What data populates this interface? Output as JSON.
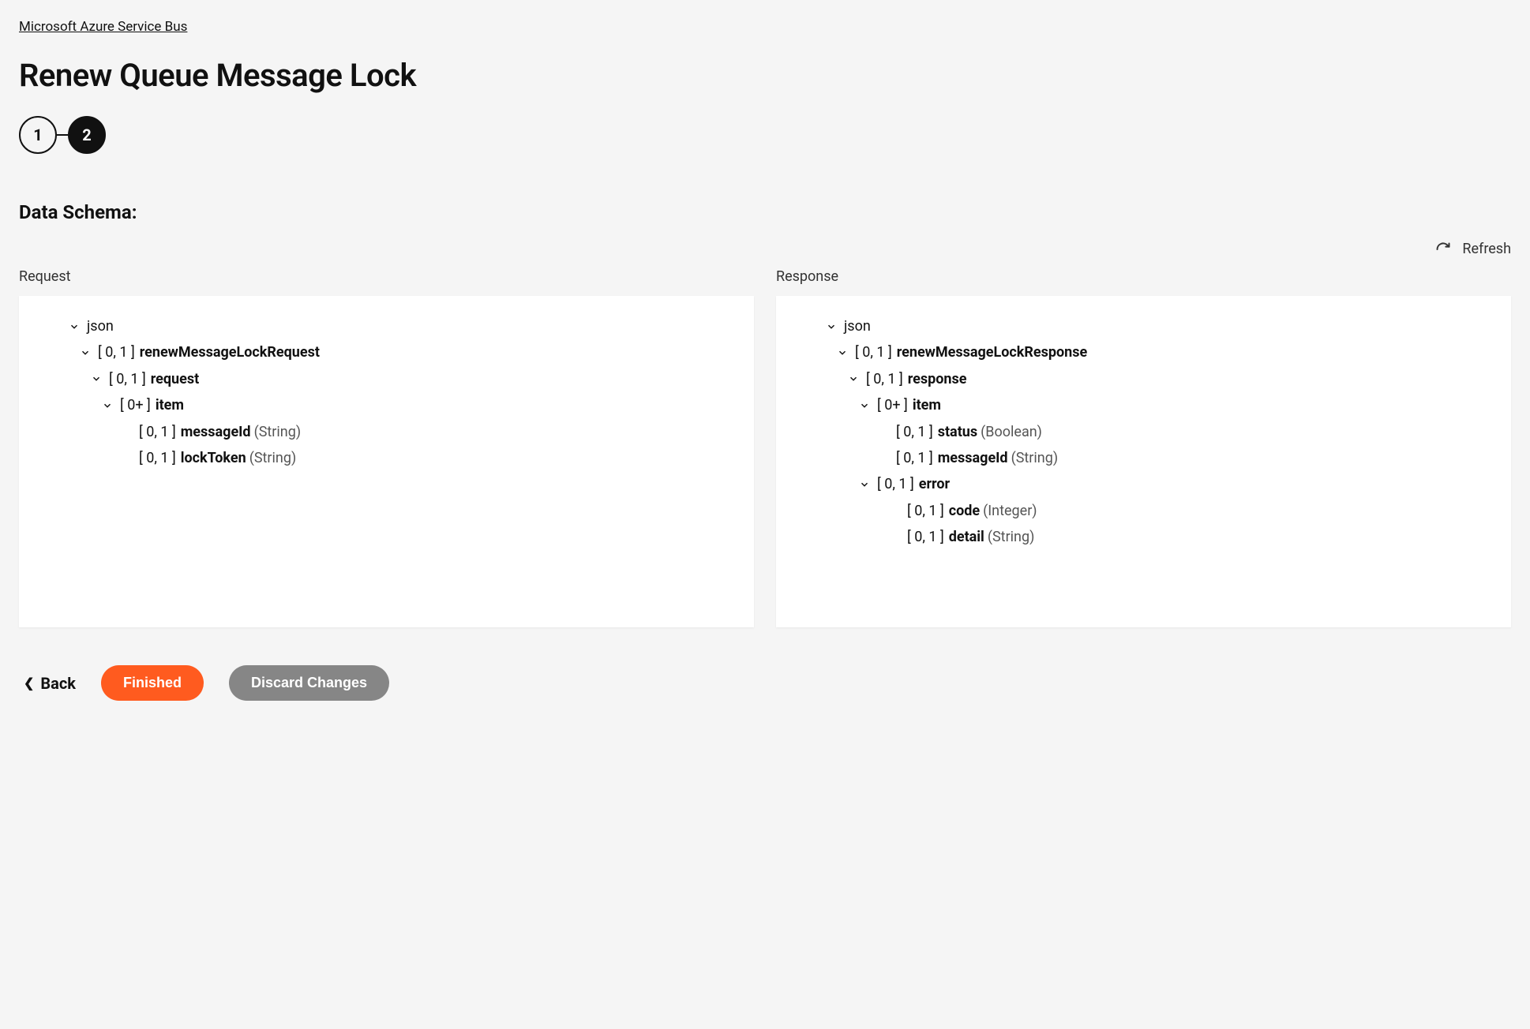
{
  "breadcrumb": "Microsoft Azure Service Bus",
  "pageTitle": "Renew Queue Message Lock",
  "stepper": {
    "step1": "1",
    "step2": "2"
  },
  "sectionTitle": "Data Schema:",
  "refreshLabel": "Refresh",
  "panels": {
    "request": {
      "label": "Request",
      "root": "json",
      "n1": {
        "card": "[ 0, 1 ]",
        "name": "renewMessageLockRequest"
      },
      "n2": {
        "card": "[ 0, 1 ]",
        "name": "request"
      },
      "n3": {
        "card": "[ 0+ ]",
        "name": "item"
      },
      "leaf1": {
        "card": "[ 0, 1 ]",
        "name": "messageId",
        "type": "(String)"
      },
      "leaf2": {
        "card": "[ 0, 1 ]",
        "name": "lockToken",
        "type": "(String)"
      }
    },
    "response": {
      "label": "Response",
      "root": "json",
      "n1": {
        "card": "[ 0, 1 ]",
        "name": "renewMessageLockResponse"
      },
      "n2": {
        "card": "[ 0, 1 ]",
        "name": "response"
      },
      "n3": {
        "card": "[ 0+ ]",
        "name": "item"
      },
      "leaf1": {
        "card": "[ 0, 1 ]",
        "name": "status",
        "type": "(Boolean)"
      },
      "leaf2": {
        "card": "[ 0, 1 ]",
        "name": "messageId",
        "type": "(String)"
      },
      "n4": {
        "card": "[ 0, 1 ]",
        "name": "error"
      },
      "leaf3": {
        "card": "[ 0, 1 ]",
        "name": "code",
        "type": "(Integer)"
      },
      "leaf4": {
        "card": "[ 0, 1 ]",
        "name": "detail",
        "type": "(String)"
      }
    }
  },
  "buttons": {
    "back": "Back",
    "finished": "Finished",
    "discard": "Discard Changes"
  }
}
